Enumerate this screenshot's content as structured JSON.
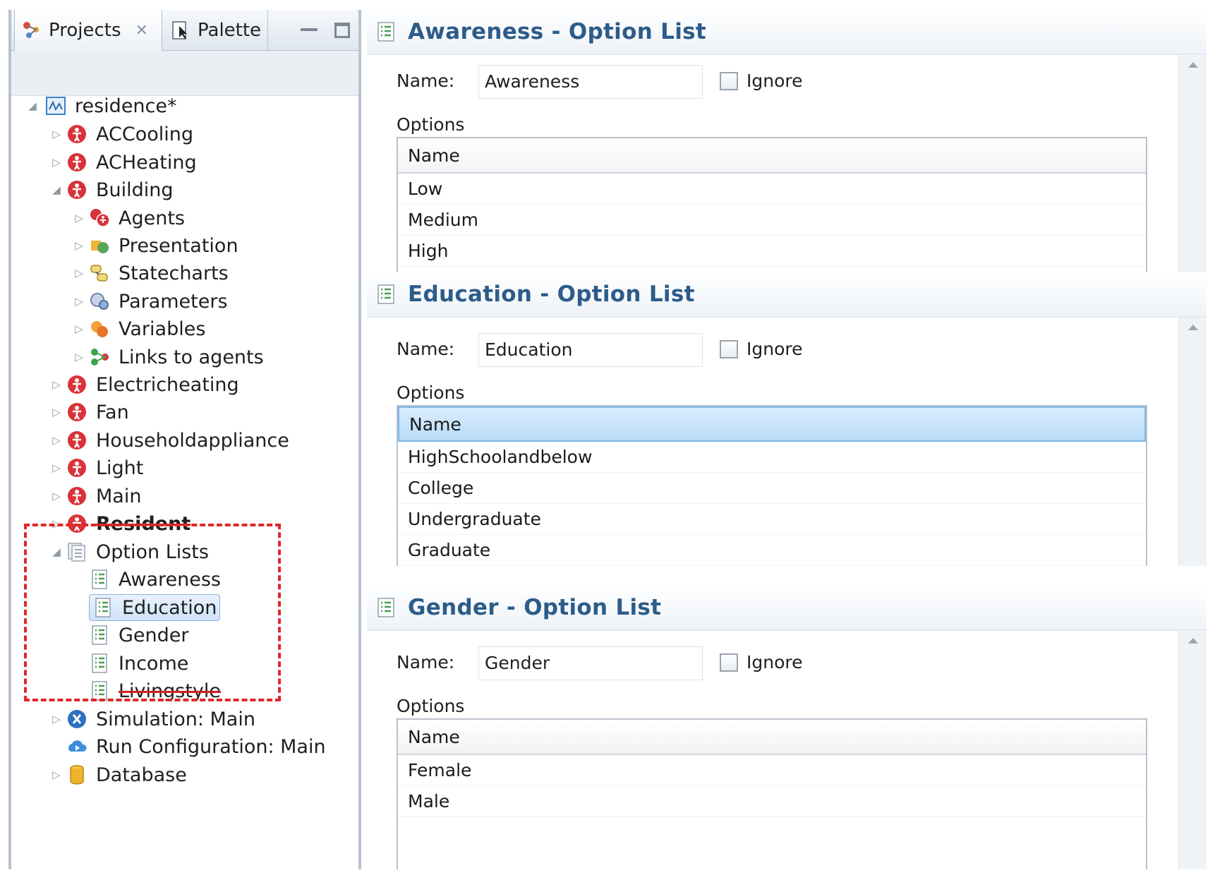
{
  "projects_view": {
    "tabs": [
      {
        "label": "Projects",
        "icon": "projects-icon",
        "active": true
      },
      {
        "label": "Palette",
        "icon": "palette-icon",
        "active": false
      }
    ],
    "tree": {
      "root": "residence*",
      "agents": [
        "ACCooling",
        "ACHeating",
        "Building"
      ],
      "building_children": [
        "Agents",
        "Presentation",
        "Statecharts",
        "Parameters",
        "Variables",
        "Links to agents"
      ],
      "agents_after": [
        "Electricheating",
        "Fan",
        "Householdappliance",
        "Light",
        "Main",
        "Resident"
      ],
      "option_lists_label": "Option Lists",
      "option_lists": [
        "Awareness",
        "Education",
        "Gender",
        "Income",
        "Livingstyle"
      ],
      "selected": "Education",
      "extras": [
        "Simulation: Main",
        "Run Configuration: Main",
        "Database"
      ]
    },
    "highlight_color": "#e02828"
  },
  "editors": [
    {
      "title": "Awareness - Option List",
      "name_label": "Name:",
      "name_value": "Awareness",
      "ignore_label": "Ignore",
      "options_label": "Options",
      "column_header": "Name",
      "rows": [
        "Low",
        "Medium",
        "High"
      ]
    },
    {
      "title": "Education - Option List",
      "name_label": "Name:",
      "name_value": "Education",
      "ignore_label": "Ignore",
      "options_label": "Options",
      "column_header": "Name",
      "rows": [
        "HighSchoolandbelow",
        "College",
        "Undergraduate",
        "Graduate"
      ]
    },
    {
      "title": "Gender - Option List",
      "name_label": "Name:",
      "name_value": "Gender",
      "ignore_label": "Ignore",
      "options_label": "Options",
      "column_header": "Name",
      "rows": [
        "Female",
        "Male"
      ]
    }
  ],
  "colors": {
    "section_title": "#2d5c8a",
    "agent_icon": "#d9323a",
    "selection": "#cfe2f8"
  }
}
